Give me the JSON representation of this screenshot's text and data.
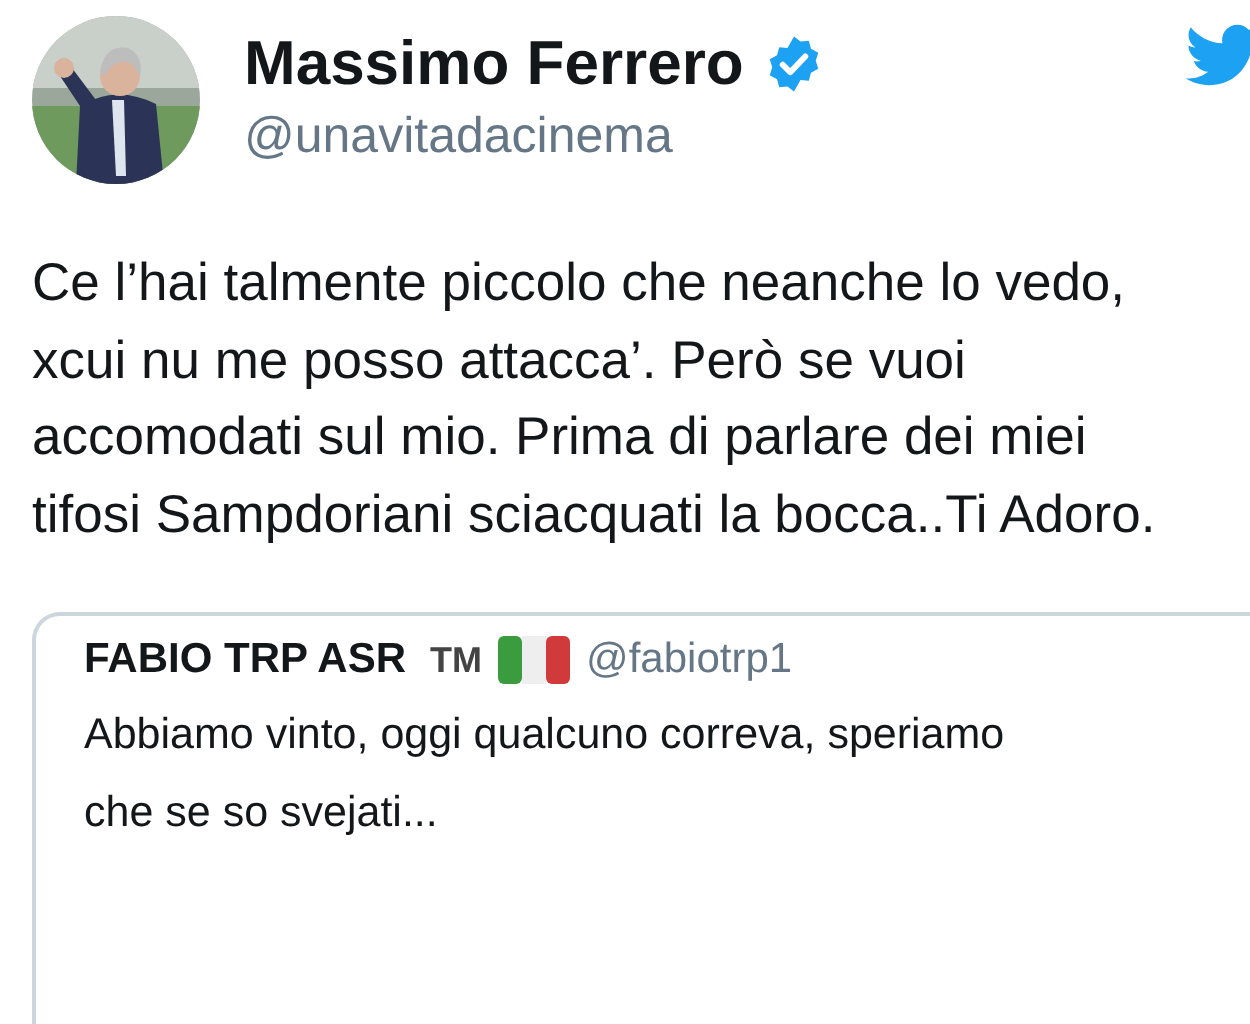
{
  "author": {
    "name": "Massimo Ferrero",
    "verified": true,
    "handle": "@unavitadacinema"
  },
  "tweet": {
    "text": "Ce l’hai talmente piccolo che neanche lo vedo, xcui nu me posso attacca’. Però se vuoi accomodati sul mio. Prima di parlare dei miei  tifosi Sampdoriani sciacquati la bocca..Ti Adoro."
  },
  "quoted_tweet": {
    "name": "FABIO TRP ASR",
    "name_suffix": "TM",
    "handle": "@fabiotrp1",
    "text": "Abbiamo vinto, oggi qualcuno correva, speriamo che se so svejati..."
  }
}
